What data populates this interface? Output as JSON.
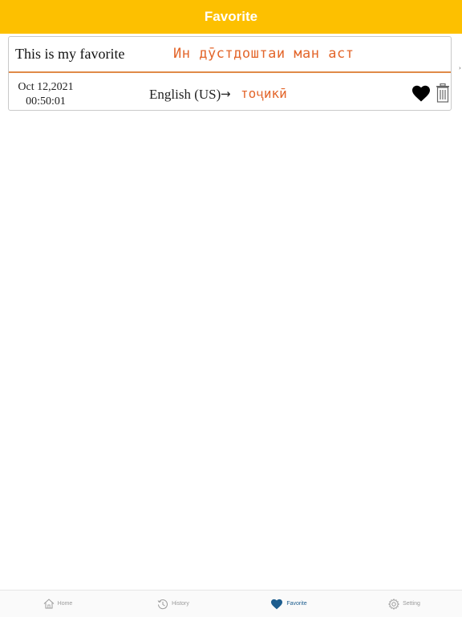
{
  "header": {
    "title": "Favorite"
  },
  "favorite_item": {
    "source_text": "This is my favorite",
    "translated_text": "Ин дӯстдоштаи ман аст",
    "date": "Oct 12,2021",
    "time": "00:50:01",
    "source_language": "English (US)",
    "arrow": "→",
    "target_language": "тоҷикӣ",
    "favorite_icon": "heart-filled-icon",
    "delete_icon": "trash-icon"
  },
  "tabs": [
    {
      "label": "Home",
      "icon": "home-icon",
      "active": false
    },
    {
      "label": "History",
      "icon": "history-icon",
      "active": false
    },
    {
      "label": "Favorite",
      "icon": "heart-icon",
      "active": true
    },
    {
      "label": "Setting",
      "icon": "gear-icon",
      "active": false
    }
  ],
  "colors": {
    "header_bg": "#fdc000",
    "accent_text": "#e3662b",
    "active_tab": "#1d5d8e",
    "inactive_tab": "#9a9a9a"
  }
}
